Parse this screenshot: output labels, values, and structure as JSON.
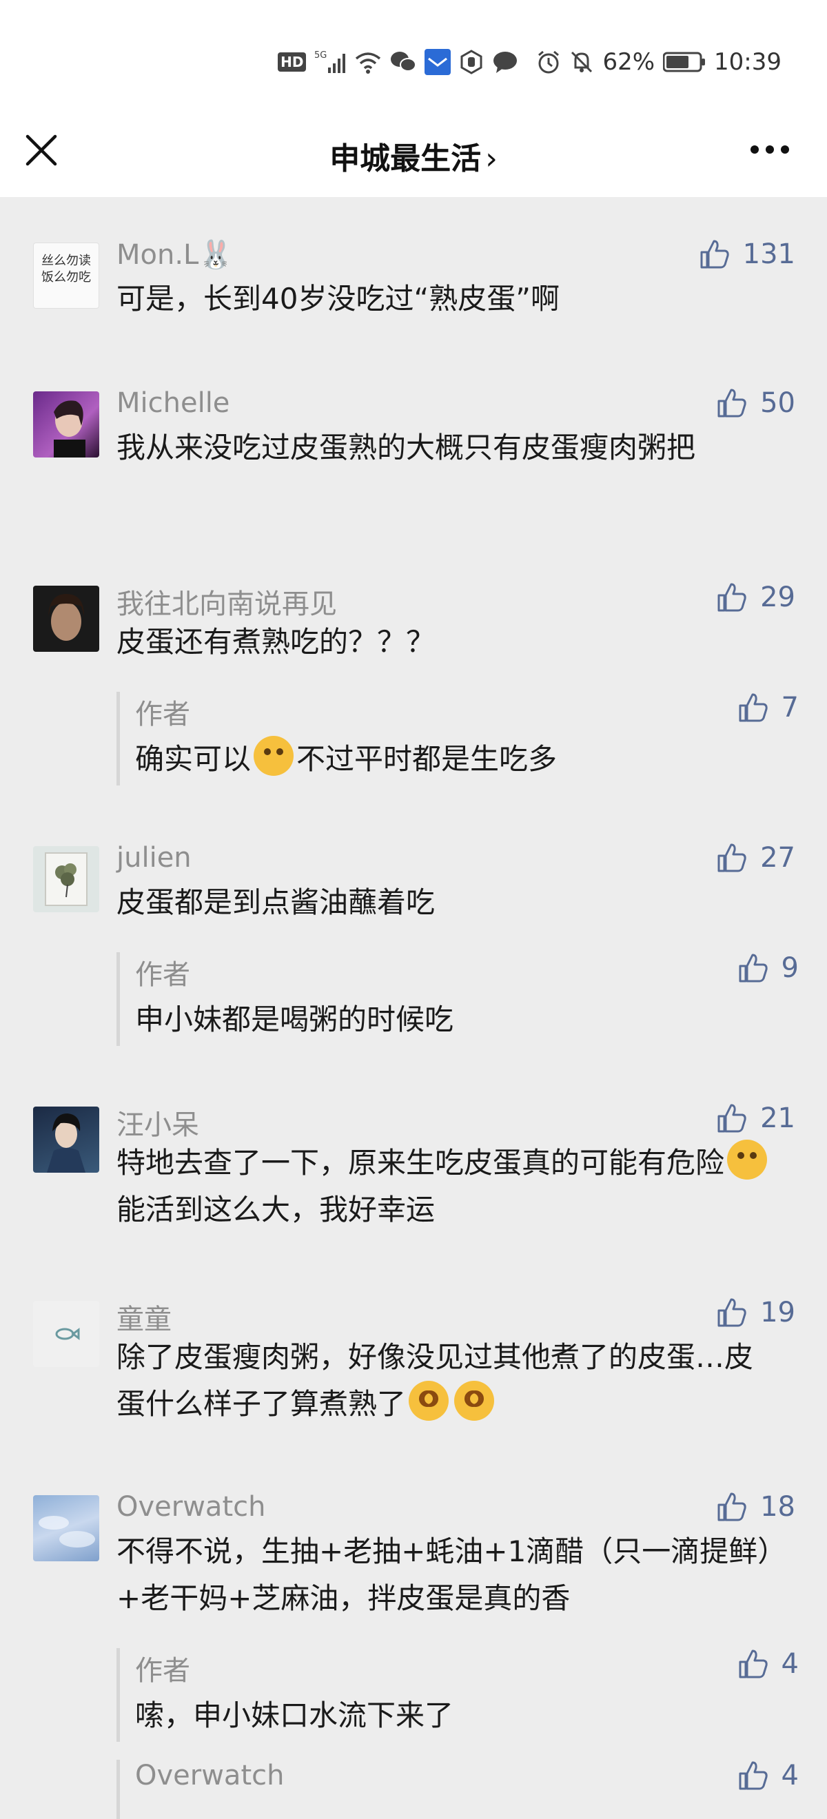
{
  "status_bar": {
    "hd": "HD",
    "network": "5G",
    "battery": "62%",
    "time": "10:39"
  },
  "nav": {
    "title": "申城最生活",
    "chevron": "›"
  },
  "comments": [
    {
      "name": "Mon.L🐰",
      "likes": "131",
      "text": "可是，长到40岁没吃过“熟皮蛋”啊",
      "avatar": "丝么勿读 饭么勿吃"
    },
    {
      "name": "Michelle",
      "likes": "50",
      "text": "我从来没吃过皮蛋熟的大概只有皮蛋瘦肉粥把"
    },
    {
      "name": "我往北向南说再见",
      "likes": "29",
      "text": "皮蛋还有煮熟吃的？？？",
      "reply": {
        "name": "作者",
        "likes": "7",
        "text_a": "确实可以",
        "text_b": "不过平时都是生吃多"
      }
    },
    {
      "name": "julien",
      "likes": "27",
      "text": "皮蛋都是到点酱油蘸着吃",
      "reply": {
        "name": "作者",
        "likes": "9",
        "text_a": "申小妹都是喝粥的时候吃"
      }
    },
    {
      "name": "汪小呆",
      "likes": "21",
      "text_a": "特地去查了一下，原来生吃皮蛋真的可能有危险",
      "text_b": "能活到这么大，我好幸运"
    },
    {
      "name": "童童",
      "likes": "19",
      "text": "除了皮蛋瘦肉粥，好像没见过其他煮了的皮蛋…皮蛋什么样子了算煮熟了"
    },
    {
      "name": "Overwatch",
      "likes": "18",
      "text": "不得不说，生抽+老抽+蚝油+1滴醋（只一滴提鲜）+老干妈+芝麻油，拌皮蛋是真的香",
      "reply": {
        "name": "作者",
        "likes": "4",
        "text_a": "嗦，申小妹口水流下来了"
      },
      "reply2": {
        "name": "Overwatch",
        "likes": "4"
      }
    }
  ],
  "colors": {
    "accent": "#576b95",
    "muted": "#8e8e8e",
    "bg": "#ededed"
  }
}
